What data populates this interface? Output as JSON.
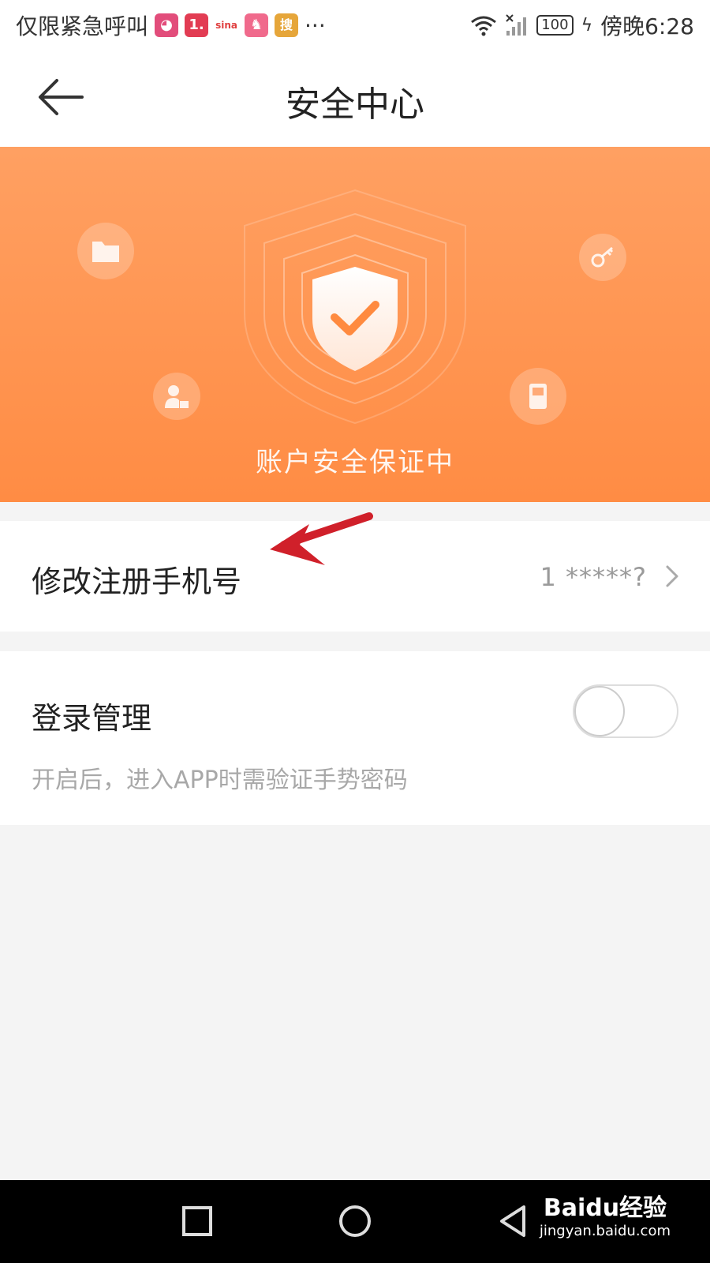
{
  "status_bar": {
    "left_text": "仅限紧急呼叫",
    "app_icons": [
      {
        "name": "weibo-app-icon",
        "glyph": "◕",
        "color": "#e24d7b"
      },
      {
        "name": "news-app-icon",
        "glyph": "1.",
        "color": "#e23c53"
      },
      {
        "name": "sina-app-icon",
        "glyph": "sina",
        "color": "#e04040"
      },
      {
        "name": "bird-app-icon",
        "glyph": "♞",
        "color": "#f06a8c"
      },
      {
        "name": "sogou-app-icon",
        "glyph": "搜",
        "color": "#e6a63a"
      }
    ],
    "more": "···",
    "battery": "100",
    "time_text": "傍晚6:28"
  },
  "header": {
    "title": "安全中心"
  },
  "banner": {
    "text": "账户安全保证中",
    "colors": {
      "top": "#ffa062",
      "bottom": "#ff8c44"
    },
    "icons": [
      "folder-icon",
      "key-icon",
      "user-lock-icon",
      "phone-icon",
      "shield-check-icon"
    ]
  },
  "phone_row": {
    "label": "修改注册手机号",
    "value": "1 *****?",
    "chevron": ">"
  },
  "login_row": {
    "label": "登录管理",
    "description": "开启后，进入APP时需验证手势密码",
    "toggle_on": false
  },
  "nav": {
    "watermark_brand": "Baidu经验",
    "watermark_url": "jingyan.baidu.com"
  }
}
